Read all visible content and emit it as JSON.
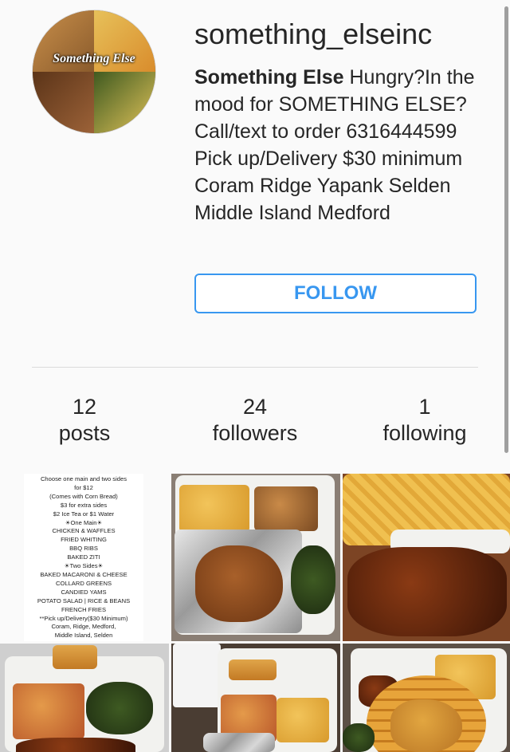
{
  "profile": {
    "username": "something_elseinc",
    "avatar_text": "Something Else",
    "bio_name": "Something Else",
    "bio_text": " Hungry?In the mood for SOMETHING ELSE?Call/text to order 6316444599 Pick up/Delivery $30 minimum Coram Ridge Yapank Selden Middle Island Medford",
    "follow_label": "FOLLOW"
  },
  "stats": [
    {
      "num": "12",
      "label": "posts"
    },
    {
      "num": "24",
      "label": "followers"
    },
    {
      "num": "1",
      "label": "following"
    }
  ],
  "menu_post": {
    "lines": [
      "Choose one main and two sides",
      "for $12",
      "(Comes with Corn Bread)",
      "$3 for extra sides",
      "$2 Ice Tea or $1 Water",
      "☀One Main☀",
      "CHICKEN & WAFFLES",
      "FRIED WHITING",
      "BBQ RIBS",
      "BAKED ZITI",
      "☀Two Sides☀",
      "BAKED MACARONI & CHEESE",
      "COLLARD GREENS",
      "CANDIED YAMS",
      "POTATO SALAD | RICE & BEANS",
      "FRENCH FRIES",
      "**Pick up/Delivery($30 Minimum)",
      "Coram, Ridge, Medford,",
      "Middle Island, Selden"
    ]
  },
  "colors": {
    "accent": "#3897f0",
    "text": "#262626",
    "background": "#fafafa",
    "divider": "#dbdbdb"
  }
}
